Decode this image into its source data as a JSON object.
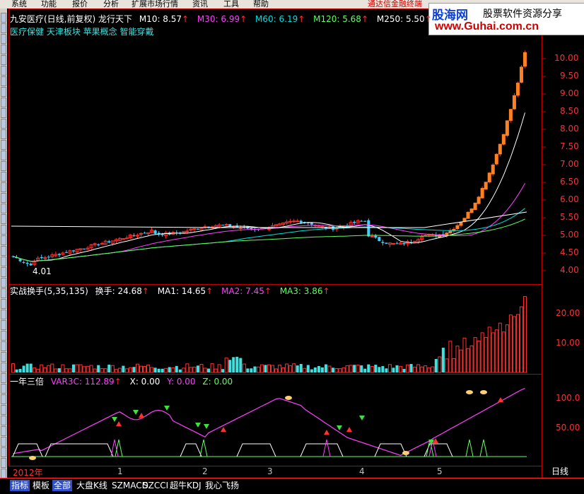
{
  "menu": [
    "系统",
    "功能",
    "报价",
    "分析",
    "扩展市场行情",
    "资讯",
    "工具",
    "帮助"
  ],
  "brand_text": "通达信金融终端",
  "logo": {
    "line1": "股海网",
    "line2": "股票软件资源分享",
    "line3": "www.Guhai.com.cn"
  },
  "main_header": {
    "title": "九安医疗(日线,前复权) 龙行天下",
    "ma": [
      {
        "label": "M10: 8.57",
        "color": "#ffffff"
      },
      {
        "label": "M30: 6.99",
        "color": "#ff40ff"
      },
      {
        "label": "M60: 6.19",
        "color": "#00e0e0"
      },
      {
        "label": "M120: 5.68",
        "color": "#60ff60"
      },
      {
        "label": "M250: 5.50",
        "color": "#ffffff"
      }
    ],
    "concepts": "医疗保健 天津板块 苹果概念 智能穿戴",
    "low_label": "4.01"
  },
  "price_axis": [
    "10.00",
    "9.50",
    "9.00",
    "8.50",
    "8.00",
    "7.50",
    "7.00",
    "6.50",
    "6.00",
    "5.50",
    "5.00",
    "4.50",
    "4.00"
  ],
  "turnover_header": {
    "name": "实战换手(5,35,135)",
    "items": [
      {
        "label": "换手: 24.68",
        "color": "#ffffff"
      },
      {
        "label": "MA1: 14.65",
        "color": "#ffffff"
      },
      {
        "label": "MA2: 7.45",
        "color": "#ff40ff"
      },
      {
        "label": "MA3: 3.86",
        "color": "#60ff60"
      }
    ]
  },
  "turnover_axis": [
    "20.00",
    "10.00"
  ],
  "indicator_header": {
    "name": "一年三倍",
    "items": [
      {
        "label": "VAR3C: 112.89",
        "color": "#ff40ff"
      },
      {
        "label": "X: 0.00",
        "color": "#ffffff"
      },
      {
        "label": "Y: 0.00",
        "color": "#ff40ff"
      },
      {
        "label": "Z: 0.00",
        "color": "#60ff60"
      }
    ]
  },
  "indicator_axis": [
    "100.0",
    "50.00"
  ],
  "x_axis": [
    {
      "label": "2012年"
    },
    {
      "label": "1"
    },
    {
      "label": "2"
    },
    {
      "label": "3"
    },
    {
      "label": "4"
    },
    {
      "label": "5"
    }
  ],
  "period_label": "日线",
  "bottom_tabs": [
    {
      "label": "指标",
      "active": true
    },
    {
      "label": "模板",
      "active": false
    },
    {
      "label": "全部",
      "active": true
    },
    {
      "label": "大盘K线",
      "active": false
    },
    {
      "label": "SZMACD",
      "active": false
    },
    {
      "label": "SZCCI",
      "active": false
    },
    {
      "label": "超牛KDJ",
      "active": false
    },
    {
      "label": "我心飞扬",
      "active": false
    }
  ],
  "colors": {
    "up": "#ff3030",
    "down": "#40d0ff",
    "frame": "#c00000",
    "bg": "#000000"
  }
}
